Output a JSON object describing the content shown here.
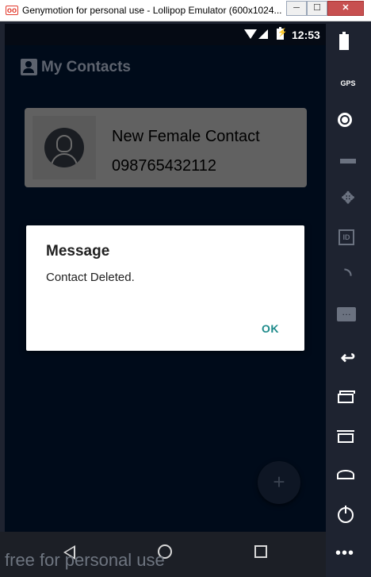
{
  "window": {
    "app_icon": "oo",
    "title": "Genymotion for personal use - Lollipop Emulator (600x1024...",
    "minimize": "─",
    "maximize": "☐",
    "close": "✕"
  },
  "status_bar": {
    "time": "12:53"
  },
  "app": {
    "title": "My Contacts"
  },
  "contact": {
    "name": "New Female Contact",
    "phone": "098765432112"
  },
  "dialog": {
    "title": "Message",
    "message": "Contact Deleted.",
    "ok_label": "OK"
  },
  "fab": {
    "label": "+"
  },
  "watermark": "free for personal use",
  "sidebar": {
    "gps_label": "GPS",
    "id_label": "ID",
    "sms_label": "…",
    "more_label": "•••"
  },
  "colors": {
    "screen_bg": "#000b1a",
    "dialog_accent": "#1d8a8a",
    "card_bg": "#616161",
    "frame_bg": "#1e2330"
  }
}
